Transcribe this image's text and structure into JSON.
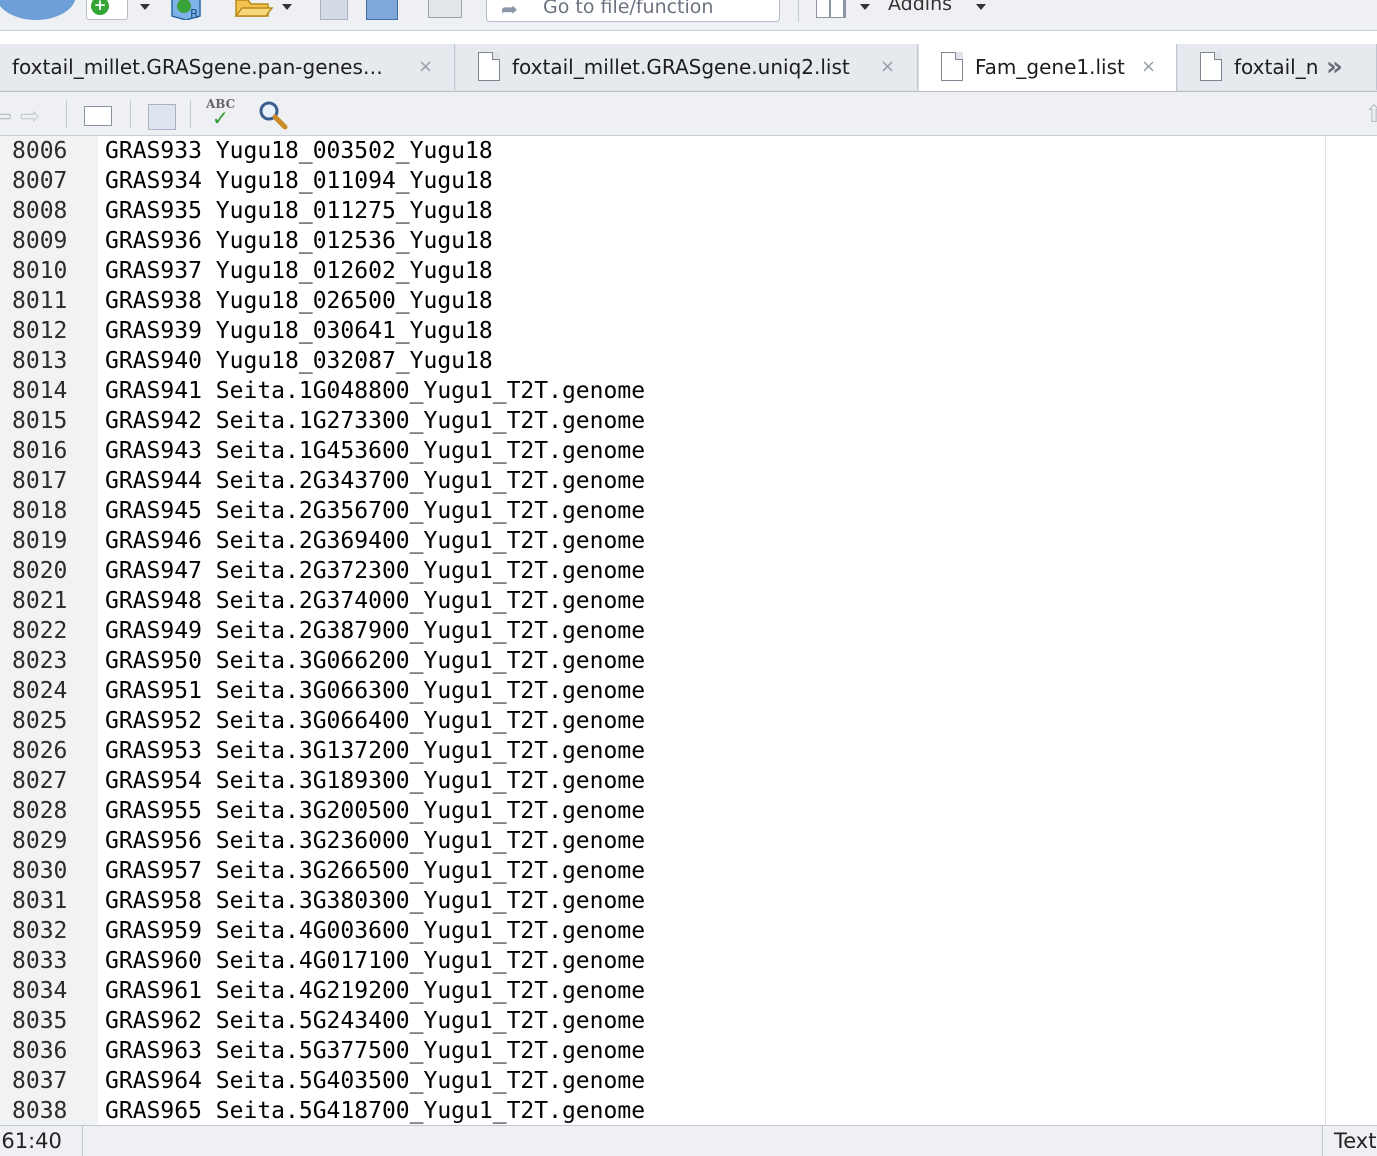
{
  "toolbar": {
    "goto_placeholder": "Go to file/function",
    "addins_label": "Addins"
  },
  "tabs": [
    {
      "label": "foxtail_millet.GRASgene.pan-genes…",
      "close": "×",
      "active": false
    },
    {
      "label": "foxtail_millet.GRASgene.uniq2.list",
      "close": "×",
      "active": false
    },
    {
      "label": "Fam_gene1.list",
      "close": "×",
      "active": true
    },
    {
      "label": "foxtail_n",
      "close": "",
      "active": false
    }
  ],
  "tab_overflow": "»",
  "editor": {
    "lines": [
      {
        "n": "8006",
        "text": "GRAS933 Yugu18_003502_Yugu18"
      },
      {
        "n": "8007",
        "text": "GRAS934 Yugu18_011094_Yugu18"
      },
      {
        "n": "8008",
        "text": "GRAS935 Yugu18_011275_Yugu18"
      },
      {
        "n": "8009",
        "text": "GRAS936 Yugu18_012536_Yugu18"
      },
      {
        "n": "8010",
        "text": "GRAS937 Yugu18_012602_Yugu18"
      },
      {
        "n": "8011",
        "text": "GRAS938 Yugu18_026500_Yugu18"
      },
      {
        "n": "8012",
        "text": "GRAS939 Yugu18_030641_Yugu18"
      },
      {
        "n": "8013",
        "text": "GRAS940 Yugu18_032087_Yugu18"
      },
      {
        "n": "8014",
        "text": "GRAS941 Seita.1G048800_Yugu1_T2T.genome"
      },
      {
        "n": "8015",
        "text": "GRAS942 Seita.1G273300_Yugu1_T2T.genome"
      },
      {
        "n": "8016",
        "text": "GRAS943 Seita.1G453600_Yugu1_T2T.genome"
      },
      {
        "n": "8017",
        "text": "GRAS944 Seita.2G343700_Yugu1_T2T.genome"
      },
      {
        "n": "8018",
        "text": "GRAS945 Seita.2G356700_Yugu1_T2T.genome"
      },
      {
        "n": "8019",
        "text": "GRAS946 Seita.2G369400_Yugu1_T2T.genome"
      },
      {
        "n": "8020",
        "text": "GRAS947 Seita.2G372300_Yugu1_T2T.genome"
      },
      {
        "n": "8021",
        "text": "GRAS948 Seita.2G374000_Yugu1_T2T.genome"
      },
      {
        "n": "8022",
        "text": "GRAS949 Seita.2G387900_Yugu1_T2T.genome"
      },
      {
        "n": "8023",
        "text": "GRAS950 Seita.3G066200_Yugu1_T2T.genome"
      },
      {
        "n": "8024",
        "text": "GRAS951 Seita.3G066300_Yugu1_T2T.genome"
      },
      {
        "n": "8025",
        "text": "GRAS952 Seita.3G066400_Yugu1_T2T.genome"
      },
      {
        "n": "8026",
        "text": "GRAS953 Seita.3G137200_Yugu1_T2T.genome"
      },
      {
        "n": "8027",
        "text": "GRAS954 Seita.3G189300_Yugu1_T2T.genome"
      },
      {
        "n": "8028",
        "text": "GRAS955 Seita.3G200500_Yugu1_T2T.genome"
      },
      {
        "n": "8029",
        "text": "GRAS956 Seita.3G236000_Yugu1_T2T.genome"
      },
      {
        "n": "8030",
        "text": "GRAS957 Seita.3G266500_Yugu1_T2T.genome"
      },
      {
        "n": "8031",
        "text": "GRAS958 Seita.3G380300_Yugu1_T2T.genome"
      },
      {
        "n": "8032",
        "text": "GRAS959 Seita.4G003600_Yugu1_T2T.genome"
      },
      {
        "n": "8033",
        "text": "GRAS960 Seita.4G017100_Yugu1_T2T.genome"
      },
      {
        "n": "8034",
        "text": "GRAS961 Seita.4G219200_Yugu1_T2T.genome"
      },
      {
        "n": "8035",
        "text": "GRAS962 Seita.5G243400_Yugu1_T2T.genome"
      },
      {
        "n": "8036",
        "text": "GRAS963 Seita.5G377500_Yugu1_T2T.genome"
      },
      {
        "n": "8037",
        "text": "GRAS964 Seita.5G403500_Yugu1_T2T.genome"
      },
      {
        "n": "8038",
        "text": "GRAS965 Seita.5G418700_Yugu1_T2T.genome"
      }
    ]
  },
  "status": {
    "cursor_position": "061:40",
    "file_type": "Text"
  },
  "colors": {
    "toolbar_bg": "#eef0f3",
    "gutter_bg": "#f1f2f4",
    "accent_blue": "#6f9fd8",
    "new_green": "#33a533"
  },
  "icons": [
    "logo-ball-icon",
    "new-file-icon",
    "project-icon",
    "open-folder-icon",
    "save-icon",
    "save-all-icon",
    "print-icon",
    "goto-arrow-icon",
    "grid-layout-icon",
    "doc-icon",
    "back-arrow-icon",
    "forward-arrow-icon",
    "show-in-window-icon",
    "spellcheck-icon",
    "search-icon",
    "up-arrow-icon"
  ]
}
